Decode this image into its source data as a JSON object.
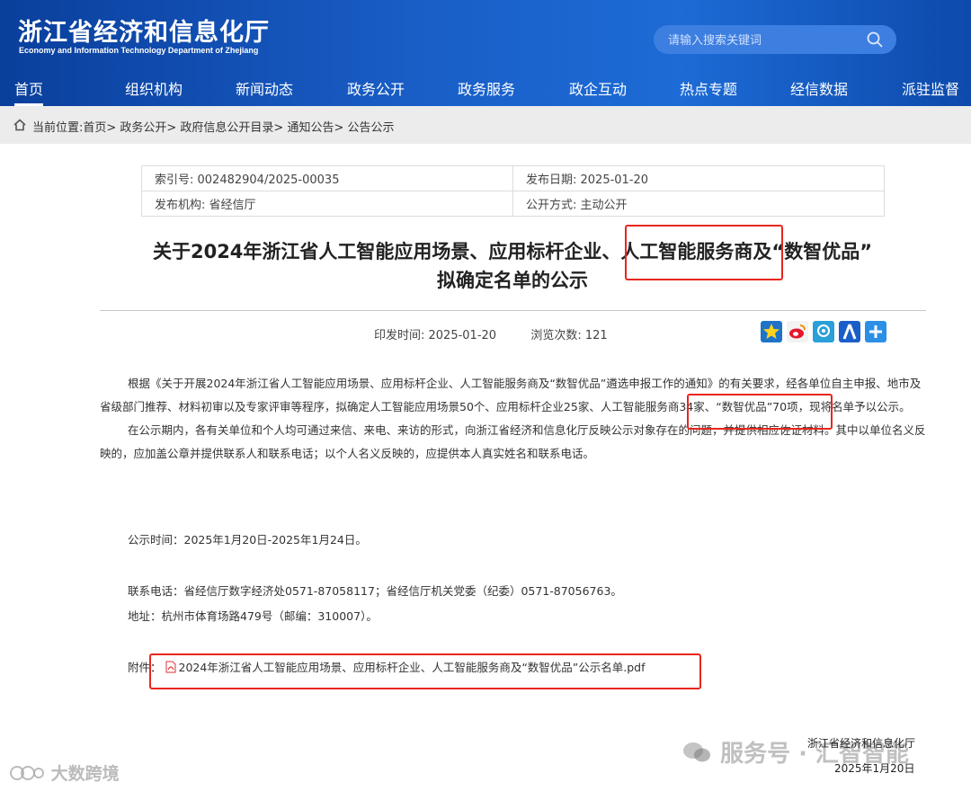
{
  "header": {
    "title": "浙江省经济和信息化厅",
    "subtitle": "Economy and Information Technology Department of Zhejiang",
    "search_placeholder": "请输入搜索关键词"
  },
  "nav": {
    "items": [
      "首页",
      "组织机构",
      "新闻动态",
      "政务公开",
      "政务服务",
      "政企互动",
      "热点专题",
      "经信数据",
      "派驻监督"
    ],
    "active_index": 0
  },
  "breadcrumb": {
    "text": "当前位置:首页> 政务公开> 政府信息公开目录> 通知公告> 公告公示"
  },
  "meta": {
    "index_no": "索引号: 002482904/2025-00035",
    "publish_date": "发布日期: 2025-01-20",
    "issuer": "发布机构: 省经信厅",
    "open_mode": "公开方式: 主动公开"
  },
  "article": {
    "title_line1": "关于2024年浙江省人工智能应用场景、应用标杆企业、人工智能服务商及“数智优品”",
    "title_line2": "拟确定名单的公示",
    "print_time": "印发时间:  2025-01-20",
    "views": "浏览次数:  121",
    "para1": "根据《关于开展2024年浙江省人工智能应用场景、应用标杆企业、人工智能服务商及“数智优品”遴选申报工作的通知》的有关要求，经各单位自主申报、地市及省级部门推荐、材料初审以及专家评审等程序，拟确定人工智能应用场景50个、应用标杆企业25家、人工智能服务商34家、“数智优品”70项，现将名单予以公示。",
    "para2": "在公示期内，各有关单位和个人均可通过来信、来电、来访的形式，向浙江省经济和信息化厅反映公示对象存在的问题，并提供相应佐证材料。其中以单位名义反映的，应加盖公章并提供联系人和联系电话；以个人名义反映的，应提供本人真实姓名和联系电话。",
    "period": "公示时间：2025年1月20日-2025年1月24日。",
    "phone": "联系电话：省经信厅数字经济处0571-87058117；省经信厅机关党委（纪委）0571-87056763。",
    "address": "地址：杭州市体育场路479号（邮编：310007）。",
    "attachment_label": "附件：",
    "attachment_file": "2024年浙江省人工智能应用场景、应用标杆企业、人工智能服务商及“数智优品”公示名单.pdf"
  },
  "footer": {
    "org": "浙江省经济和信息化厅",
    "date": "2025年1月20日"
  },
  "watermarks": {
    "right": "服务号 · 汇智智能",
    "left": "大数跨境"
  },
  "colors": {
    "header_blue": "#1a5fc8",
    "highlight_red": "#e8261c"
  }
}
